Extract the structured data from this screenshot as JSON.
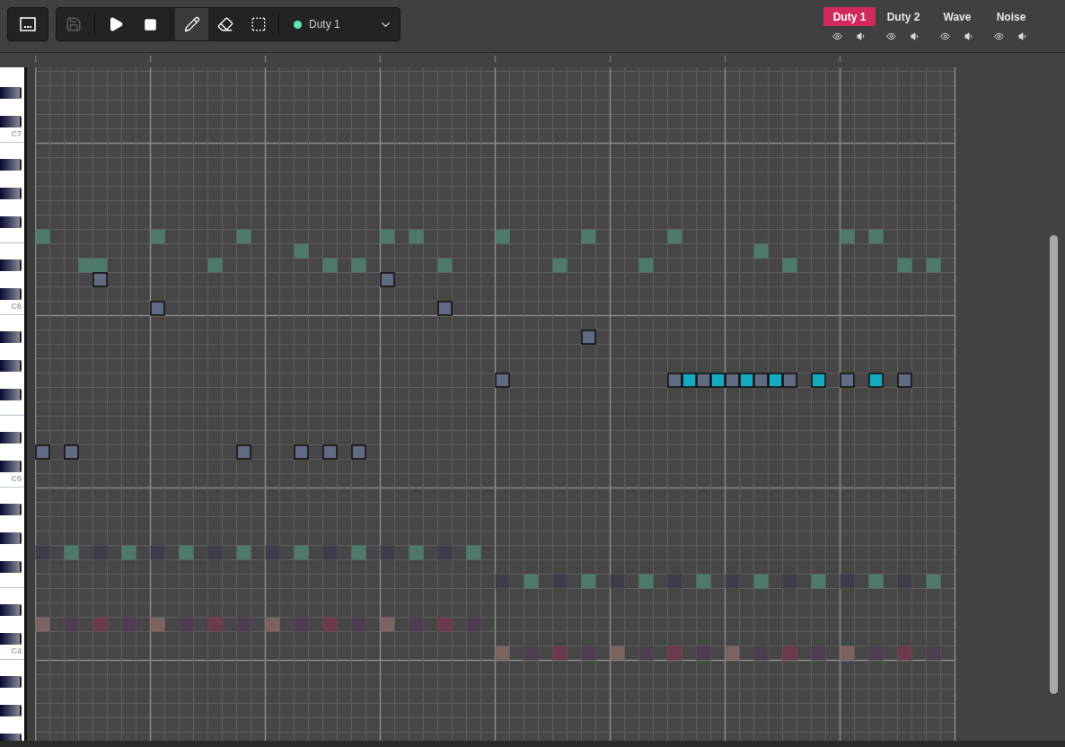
{
  "toolbar": {
    "actions": [
      {
        "kind": "save",
        "disabled": true
      },
      {
        "kind": "play",
        "disabled": false
      },
      {
        "kind": "stop",
        "disabled": false
      }
    ],
    "tools": [
      {
        "kind": "pencil",
        "selected": true
      },
      {
        "kind": "eraser",
        "selected": false
      },
      {
        "kind": "select",
        "selected": false
      }
    ],
    "channel_select": {
      "value": "Duty 1",
      "color": "#5ee8b2"
    }
  },
  "channels": [
    {
      "label": "Duty 1",
      "selected": true
    },
    {
      "label": "Duty 2",
      "selected": false
    },
    {
      "label": "Wave",
      "selected": false
    },
    {
      "label": "Noise",
      "selected": false
    }
  ],
  "piano": {
    "labels": [
      "C7",
      "C6",
      "C5",
      "C4"
    ]
  }
}
